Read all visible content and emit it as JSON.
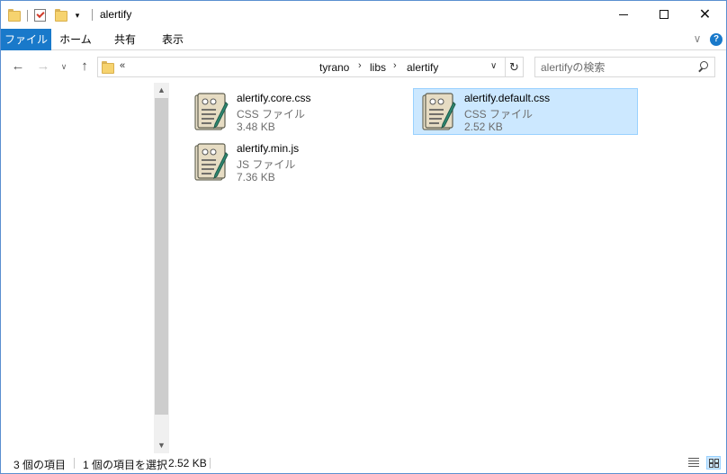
{
  "window": {
    "title": "alertify",
    "controls": {
      "minimize_icon": "minimize-icon",
      "maximize_icon": "maximize-icon",
      "close_glyph": "✕"
    }
  },
  "quick_access": {
    "dropdown_glyph": "▾"
  },
  "ribbon": {
    "tabs": [
      {
        "label": "ファイル",
        "active": true
      },
      {
        "label": "ホーム"
      },
      {
        "label": "共有"
      },
      {
        "label": "表示"
      }
    ],
    "expand_glyph": "∨",
    "help_glyph": "?"
  },
  "nav": {
    "back_glyph": "←",
    "forward_glyph": "→",
    "recent_glyph": "∨",
    "up_glyph": "↑",
    "address": {
      "overflow": "«",
      "breadcrumbs": [
        "tyrano",
        "libs",
        "alertify"
      ],
      "separator": "›",
      "dropdown_glyph": "∨"
    },
    "refresh_glyph": "↻",
    "search": {
      "placeholder": "alertifyの検索",
      "value": ""
    }
  },
  "scrollbar": {
    "up_glyph": "▲",
    "down_glyph": "▼"
  },
  "files": [
    {
      "name": "alertify.core.css",
      "type": "CSS ファイル",
      "size": "3.48 KB",
      "selected": false,
      "icon": "script-document-icon"
    },
    {
      "name": "alertify.default.css",
      "type": "CSS ファイル",
      "size": "2.52 KB",
      "selected": true,
      "icon": "script-document-icon"
    },
    {
      "name": "alertify.min.js",
      "type": "JS ファイル",
      "size": "7.36 KB",
      "selected": false,
      "icon": "script-document-icon"
    }
  ],
  "status": {
    "item_count": "3 個の項目",
    "selection": "1 個の項目を選択",
    "selection_size": "2.52 KB"
  },
  "colors": {
    "accent": "#1979ca",
    "selection_bg": "#cce8ff",
    "selection_border": "#99d1ff",
    "folder": "#f6d36f"
  }
}
